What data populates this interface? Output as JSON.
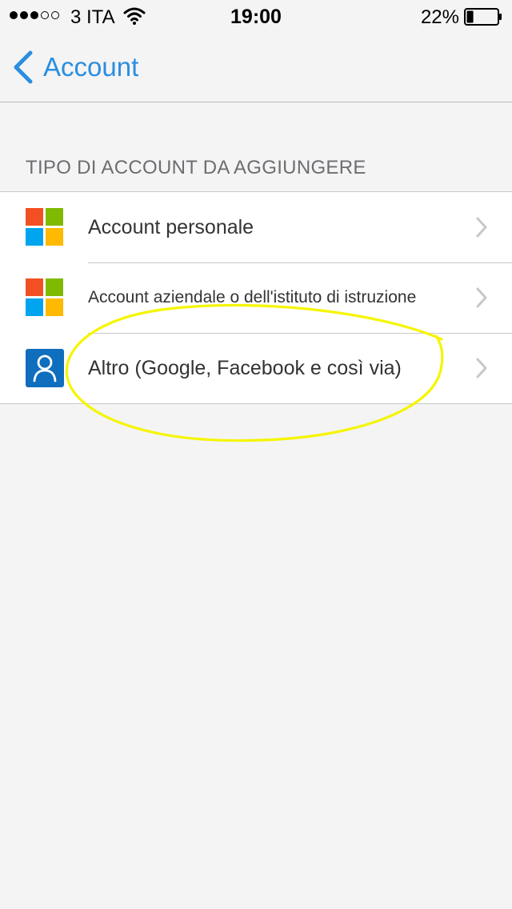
{
  "status_bar": {
    "carrier": "3 ITA",
    "time": "19:00",
    "battery_percent": "22%",
    "battery_level": 0.22,
    "signal_bars_filled": 3,
    "signal_bars_total": 5
  },
  "nav": {
    "back_label": "Account",
    "accent_color": "#2a8ee0"
  },
  "section": {
    "header": "TIPO DI ACCOUNT DA AGGIUNGERE"
  },
  "rows": [
    {
      "label": "Account personale",
      "icon": "microsoft-logo-icon"
    },
    {
      "label": "Account aziendale o dell'istituto di istruzione",
      "icon": "microsoft-logo-icon"
    },
    {
      "label": "Altro (Google, Facebook e così via)",
      "icon": "person-icon"
    }
  ],
  "microsoft_logo_colors": [
    "#f25022",
    "#7fba00",
    "#00a4ef",
    "#ffb900"
  ],
  "annotation": {
    "shape": "hand-drawn ellipse",
    "color": "#f5f500",
    "target": "Altro (Google, Facebook e così via)"
  }
}
